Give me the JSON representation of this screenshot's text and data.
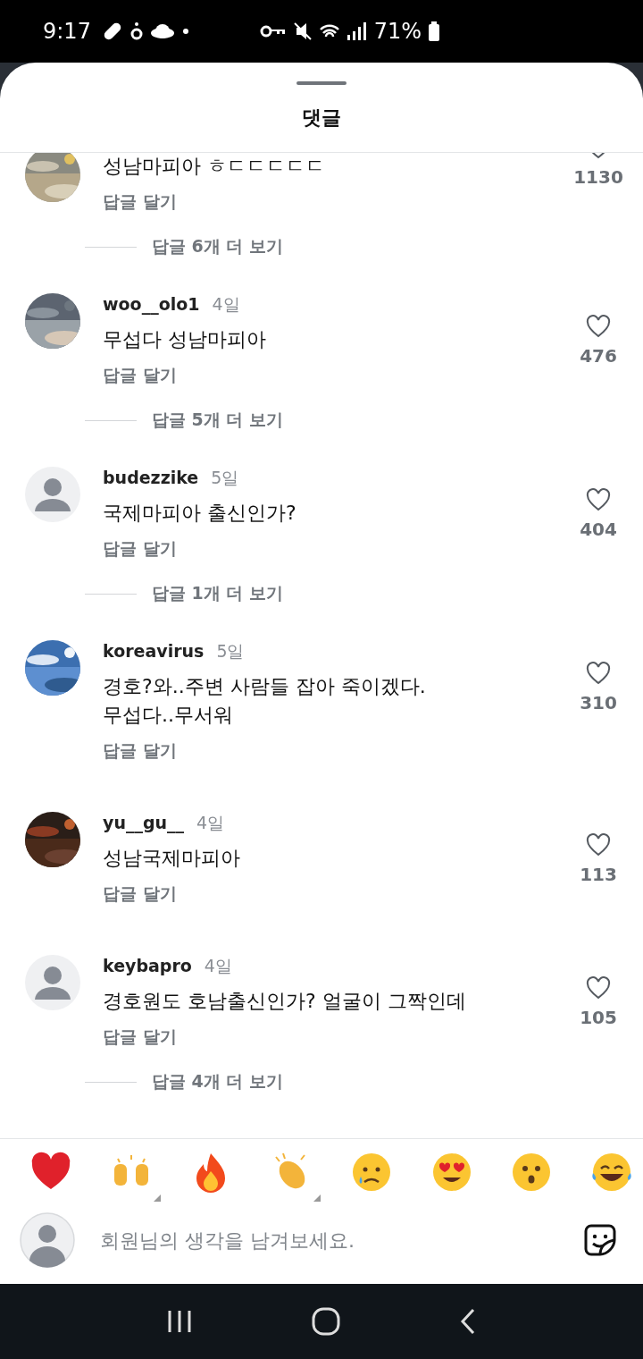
{
  "status_bar": {
    "time": "9:17",
    "battery": "71%"
  },
  "sheet": {
    "title": "댓글"
  },
  "comments": [
    {
      "kind": "photo-avatar",
      "text": "성남마피아 ㅎㄷㄷㄷㄷㄷ",
      "reply": "답글 달기",
      "likes": "1130",
      "more_replies": "답글 6개 더 보기"
    },
    {
      "kind": "photo-avatar",
      "username": "woo__olo1",
      "age": "4일",
      "text": "무섭다 성남마피아",
      "reply": "답글 달기",
      "likes": "476",
      "more_replies": "답글 5개 더 보기"
    },
    {
      "kind": "default-avatar",
      "username": "budezzike",
      "age": "5일",
      "text": "국제마피아 출신인가?",
      "reply": "답글 달기",
      "likes": "404",
      "more_replies": "답글 1개 더 보기"
    },
    {
      "kind": "photo-avatar",
      "username": "koreavirus",
      "age": "5일",
      "text": "경호?와..주변 사람들 잡아 죽이겠다.\n무섭다..무서워",
      "reply": "답글 달기",
      "likes": "310"
    },
    {
      "kind": "photo-avatar",
      "username": "yu__gu__",
      "age": "4일",
      "text": "성남국제마피아",
      "reply": "답글 달기",
      "likes": "113"
    },
    {
      "kind": "default-avatar",
      "username": "keybapro",
      "age": "4일",
      "text": "경호원도 호남출신인가? 얼굴이 그짝인데",
      "reply": "답글 달기",
      "likes": "105",
      "more_replies": "답글 4개 더 보기"
    }
  ],
  "reactions": [
    {
      "kind": "heart",
      "variants": false
    },
    {
      "kind": "raised-hands",
      "variants": true
    },
    {
      "kind": "fire",
      "variants": false
    },
    {
      "kind": "clap",
      "variants": true
    },
    {
      "kind": "crying",
      "variants": false
    },
    {
      "kind": "heart-eyes",
      "variants": false
    },
    {
      "kind": "surprised",
      "variants": false
    },
    {
      "kind": "laughing",
      "variants": false
    }
  ],
  "composer": {
    "placeholder": "회원님의 생각을 남겨보세요."
  }
}
